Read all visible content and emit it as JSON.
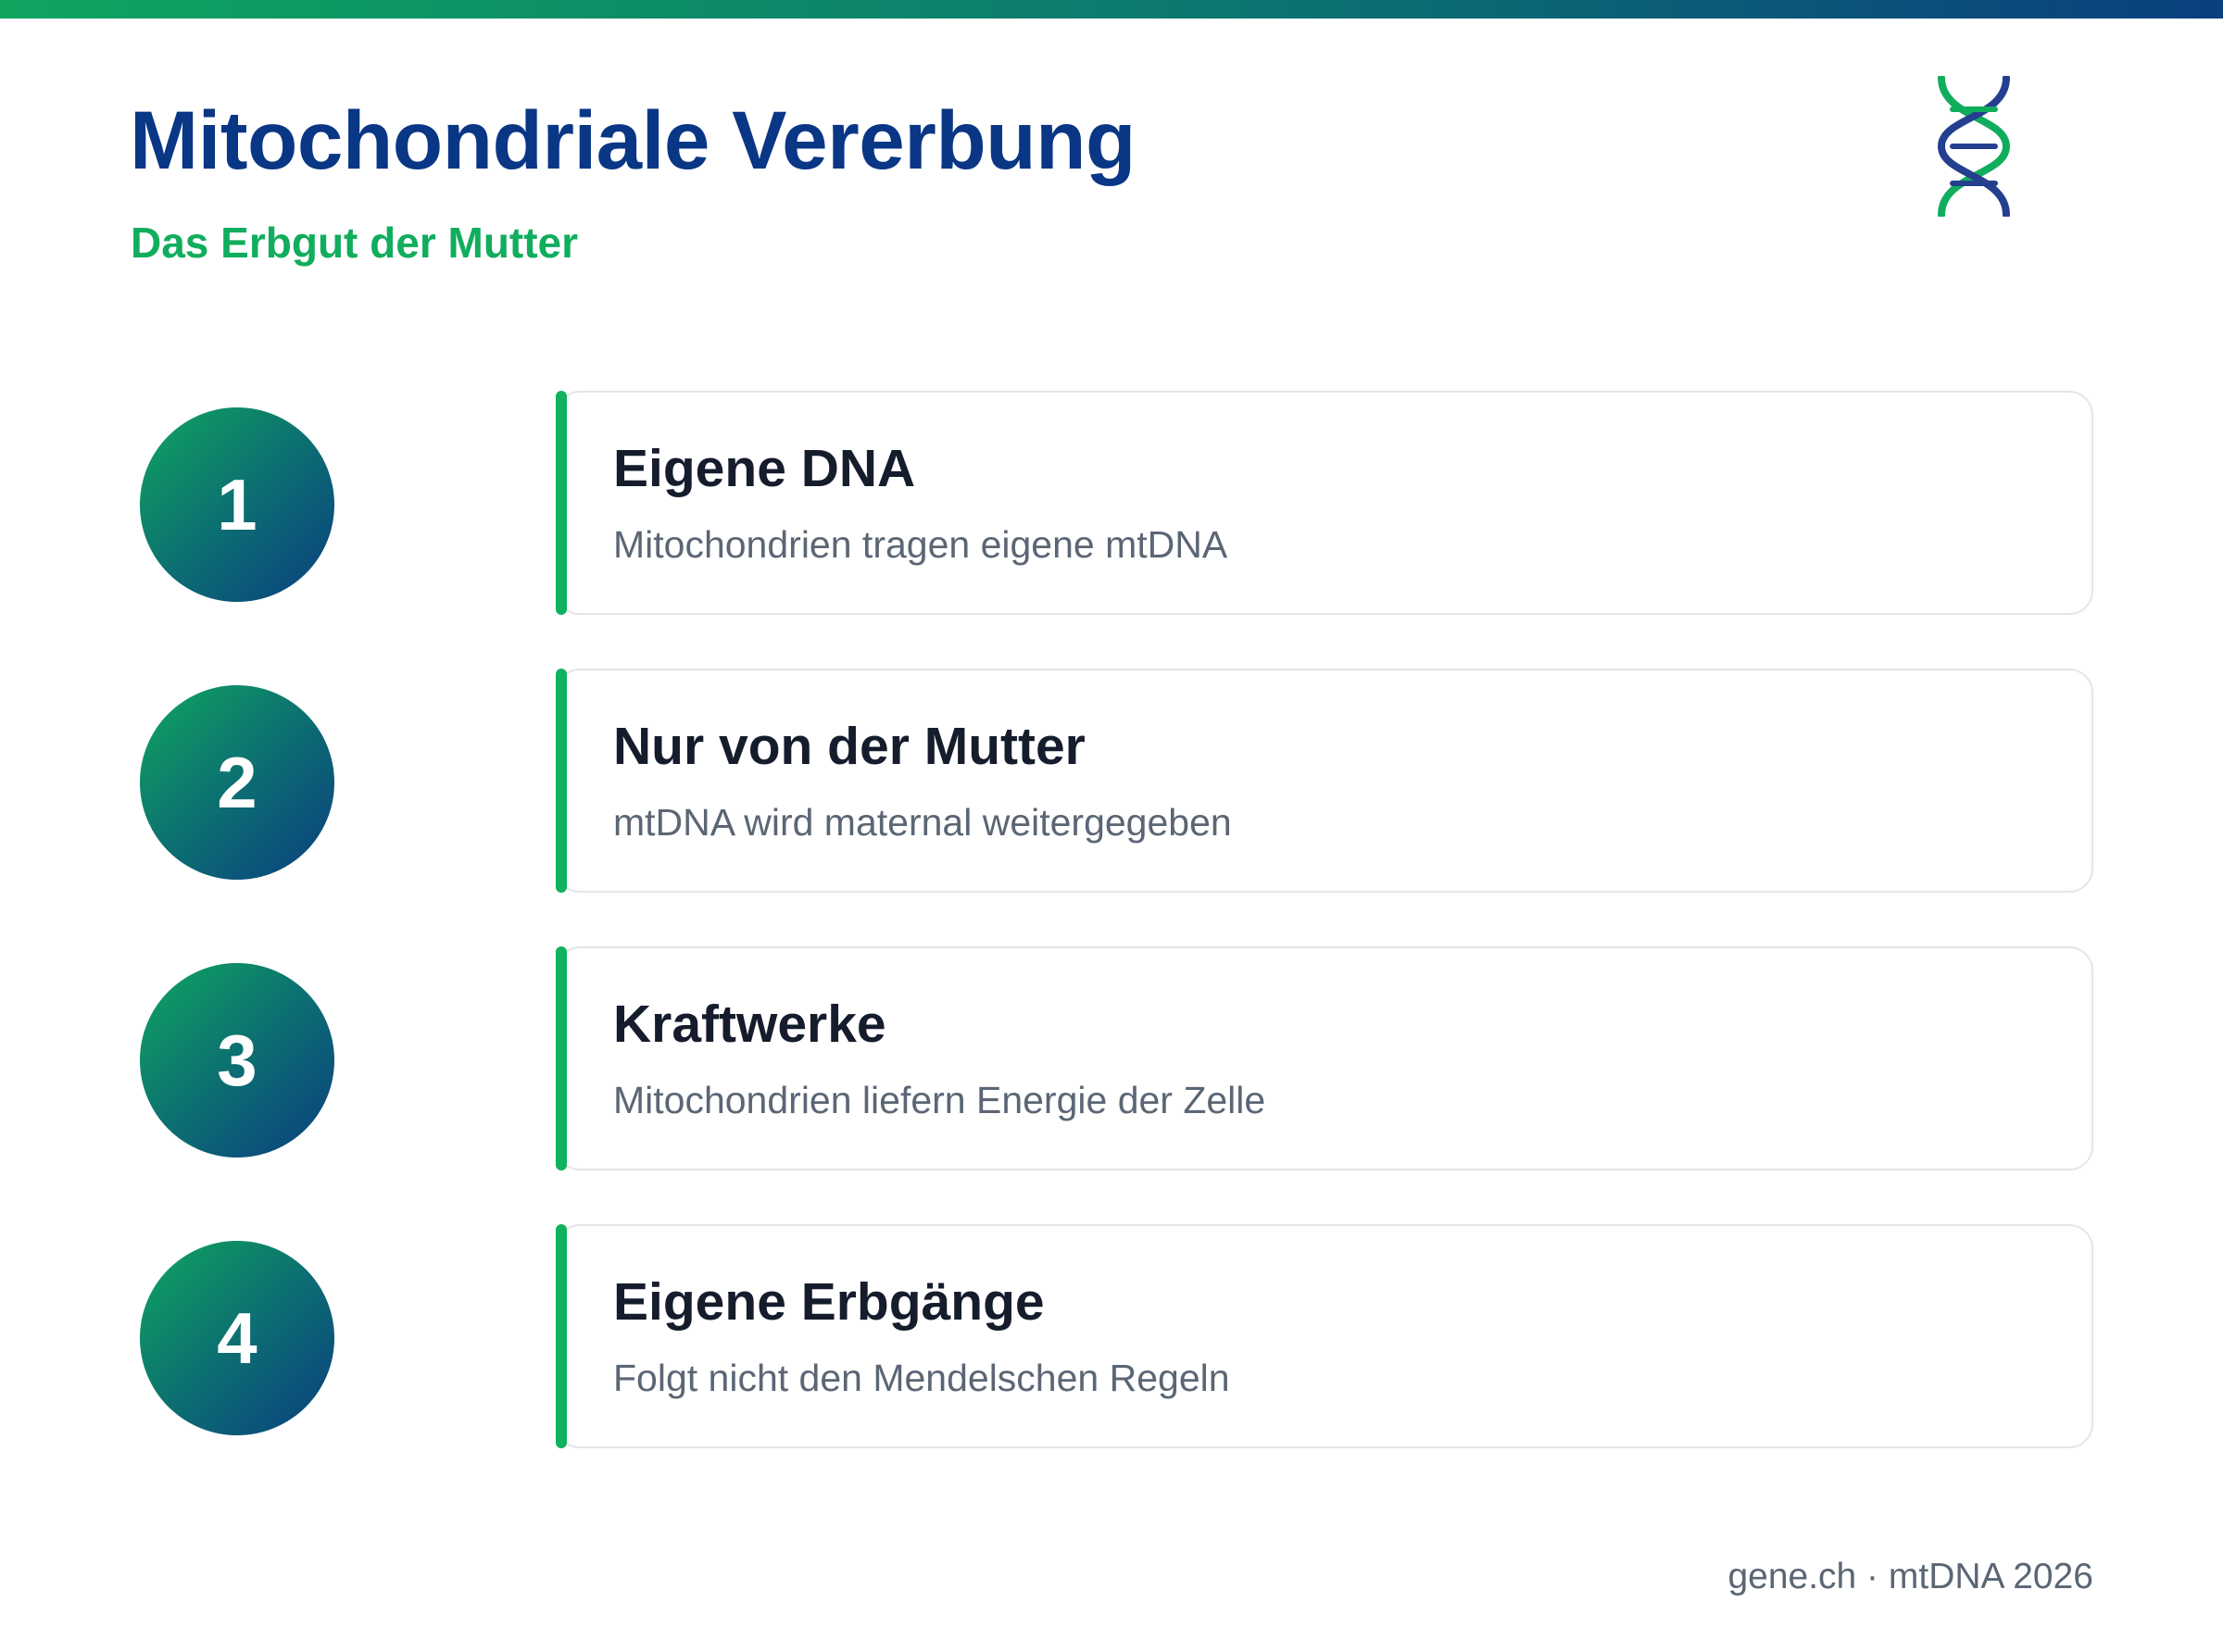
{
  "header": {
    "title": "Mitochondriale Vererbung",
    "subtitle": "Das Erbgut der Mutter",
    "logo_icon": "dna-helix-icon"
  },
  "steps": [
    {
      "number": "1",
      "title": "Eigene DNA",
      "text": "Mitochondrien tragen eigene mtDNA"
    },
    {
      "number": "2",
      "title": "Nur von der Mutter",
      "text": "mtDNA wird maternal weitergegeben"
    },
    {
      "number": "3",
      "title": "Kraftwerke",
      "text": "Mitochondrien liefern Energie der Zelle"
    },
    {
      "number": "4",
      "title": "Eigene Erbgänge",
      "text": "Folgt nicht den Mendelschen Regeln"
    }
  ],
  "footer": {
    "credit": "gene.ch · mtDNA 2026"
  },
  "colors": {
    "title": "#0a3686",
    "accent_green": "#10ad5d",
    "gradient_start": "#0fa55f",
    "gradient_end": "#0a3f7f",
    "card_title": "#151c2c",
    "card_text": "#5b6675"
  }
}
